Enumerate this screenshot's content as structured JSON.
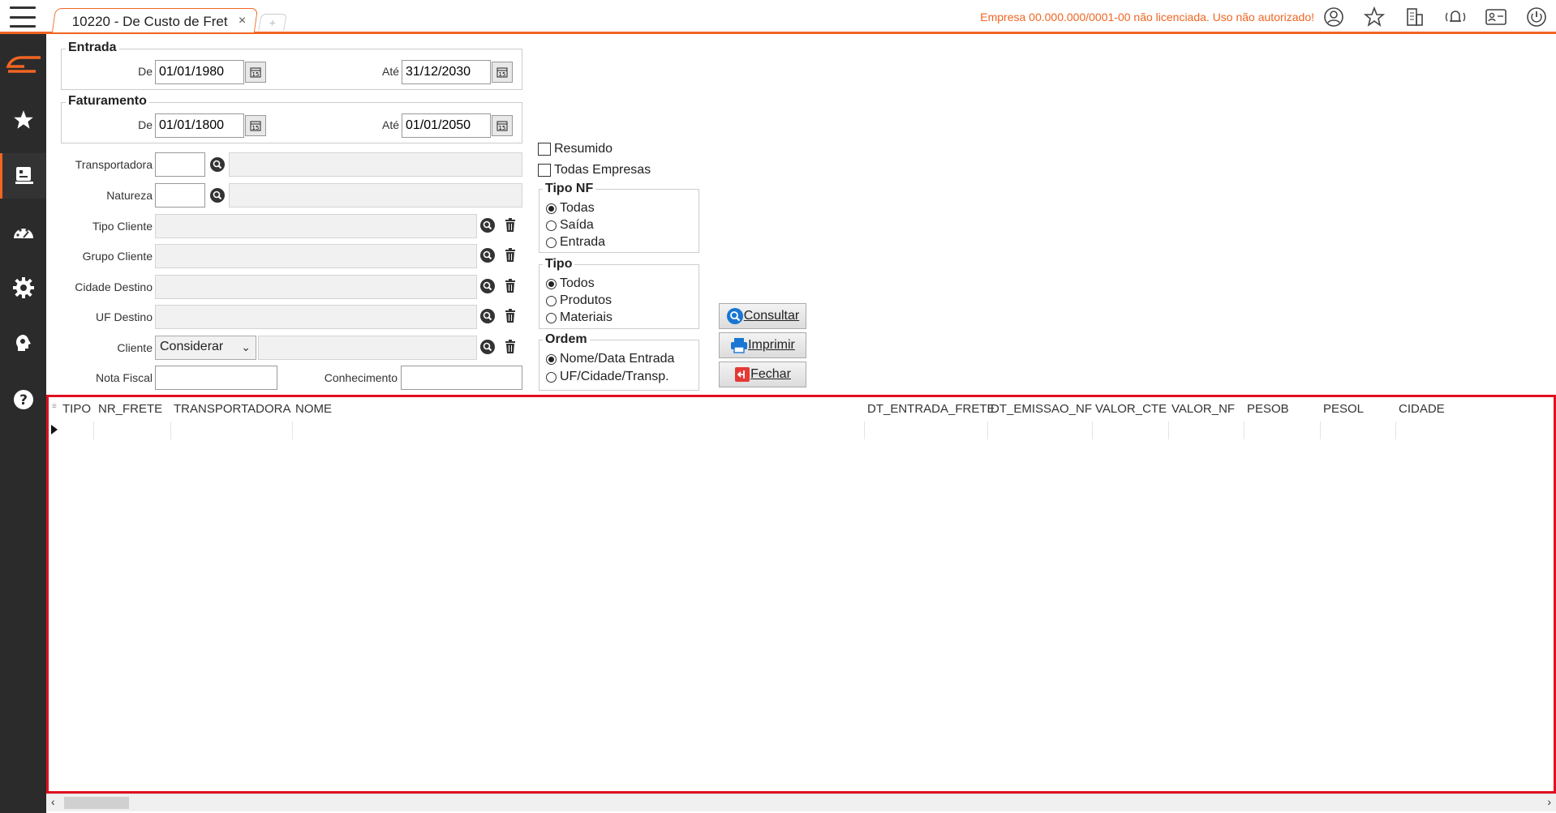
{
  "tab": {
    "title": "10220 - De Custo de Fret",
    "close": "×",
    "new_tab": "+"
  },
  "header": {
    "warning": "Empresa 00.000.000/0001-00 não licenciada. Uso não autorizado!"
  },
  "sidebar": {
    "items": [
      "logo",
      "favorites",
      "reports",
      "dashboard",
      "settings",
      "support",
      "help"
    ]
  },
  "form": {
    "entrada": {
      "title": "Entrada",
      "de_label": "De",
      "de_value": "01/01/1980",
      "ate_label": "Até",
      "ate_value": "31/12/2030"
    },
    "faturamento": {
      "title": "Faturamento",
      "de_label": "De",
      "de_value": "01/01/1800",
      "ate_label": "Até",
      "ate_value": "01/01/2050"
    },
    "transportadora_label": "Transportadora",
    "natureza_label": "Natureza",
    "tipo_cliente_label": "Tipo Cliente",
    "grupo_cliente_label": "Grupo Cliente",
    "cidade_destino_label": "Cidade Destino",
    "uf_destino_label": "UF Destino",
    "cliente_label": "Cliente",
    "cliente_select": "Considerar",
    "nota_fiscal_label": "Nota Fiscal",
    "conhecimento_label": "Conhecimento"
  },
  "options": {
    "resumido": "Resumido",
    "todas_empresas": "Todas Empresas",
    "tipo_nf": {
      "title": "Tipo NF",
      "items": [
        "Todas",
        "Saída",
        "Entrada"
      ],
      "selected": 0
    },
    "tipo": {
      "title": "Tipo",
      "items": [
        "Todos",
        "Produtos",
        "Materiais"
      ],
      "selected": 0
    },
    "ordem": {
      "title": "Ordem",
      "items": [
        "Nome/Data Entrada",
        "UF/Cidade/Transp."
      ],
      "selected": 0
    }
  },
  "buttons": {
    "consultar": "Consultar",
    "imprimir": "Imprimir",
    "fechar": "Fechar"
  },
  "grid": {
    "columns": [
      "TIPO",
      "NR_FRETE",
      "TRANSPORTADORA",
      "NOME",
      "DT_ENTRADA_FRETE",
      "DT_EMISSAO_NF",
      "VALOR_CTE",
      "VALOR_NF",
      "PESOB",
      "PESOL",
      "CIDADE"
    ]
  },
  "colors": {
    "accent": "#f26522",
    "highlight": "#e1101e",
    "sidebar": "#2b2b2b"
  }
}
